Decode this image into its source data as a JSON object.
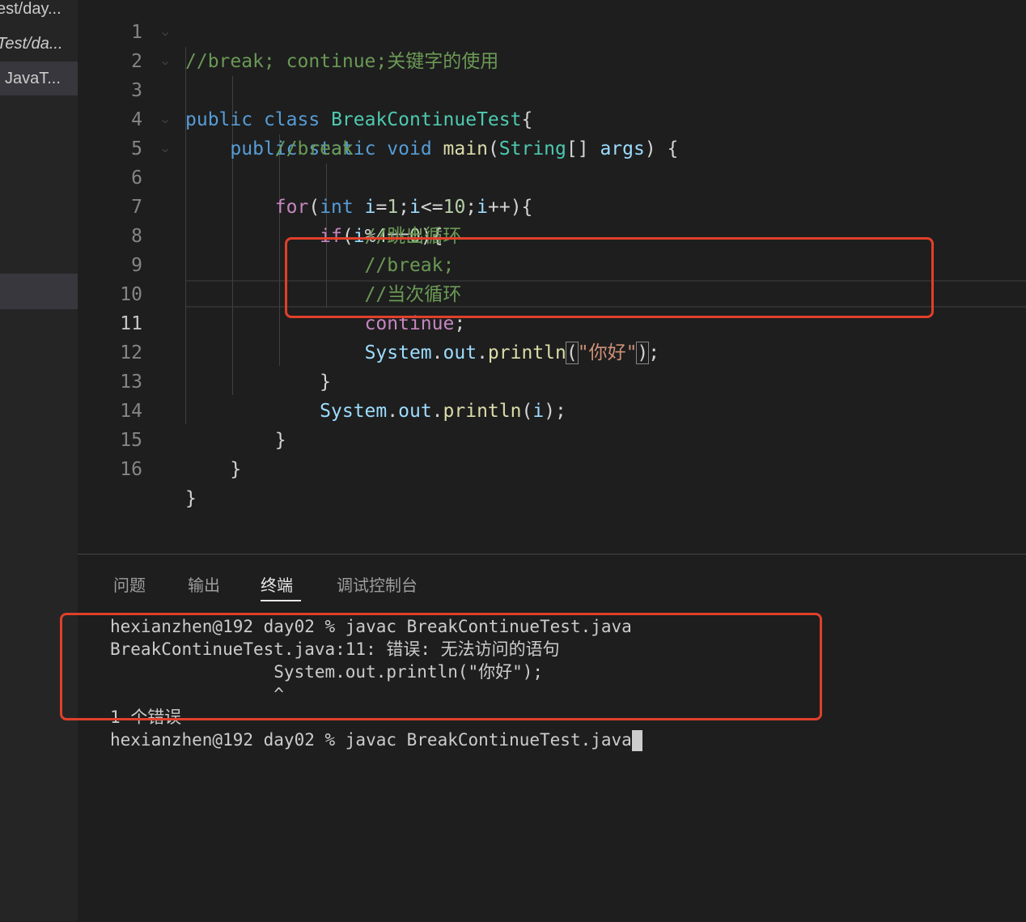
{
  "sidebar": {
    "items": [
      "est/day...",
      "Test/da...",
      "JavaT..."
    ]
  },
  "editor": {
    "lines": [
      {
        "n": "1",
        "code": "//break; continue;关键字的使用"
      },
      {
        "n": "2",
        "code": "public class BreakContinueTest{"
      },
      {
        "n": "3",
        "code": "    public static void main(String[] args) {"
      },
      {
        "n": "4",
        "code": "        //break"
      },
      {
        "n": "5",
        "code": "        for(int i=1;i<=10;i++){"
      },
      {
        "n": "6",
        "code": "            if(i%4==0){"
      },
      {
        "n": "7",
        "code": "                //跳出循环"
      },
      {
        "n": "8",
        "code": "                //break;"
      },
      {
        "n": "9",
        "code": "                //当次循环"
      },
      {
        "n": "10",
        "code": "                continue;"
      },
      {
        "n": "11",
        "code": "                System.out.println(\"你好\");"
      },
      {
        "n": "12",
        "code": "            }"
      },
      {
        "n": "13",
        "code": "            System.out.println(i);"
      },
      {
        "n": "14",
        "code": "        }"
      },
      {
        "n": "15",
        "code": "    }"
      },
      {
        "n": "16",
        "code": "}"
      }
    ]
  },
  "panel": {
    "tabs": [
      "问题",
      "输出",
      "终端",
      "调试控制台"
    ],
    "active_tab": "终端",
    "terminal": [
      "hexianzhen@192 day02 % javac BreakContinueTest.java",
      "BreakContinueTest.java:11: 错误: 无法访问的语句",
      "                System.out.println(\"你好\");",
      "                ^",
      "1 个错误",
      "hexianzhen@192 day02 % javac BreakContinueTest.java"
    ]
  },
  "colors": {
    "annotation": "#e0402a",
    "background": "#1e1e1e"
  }
}
